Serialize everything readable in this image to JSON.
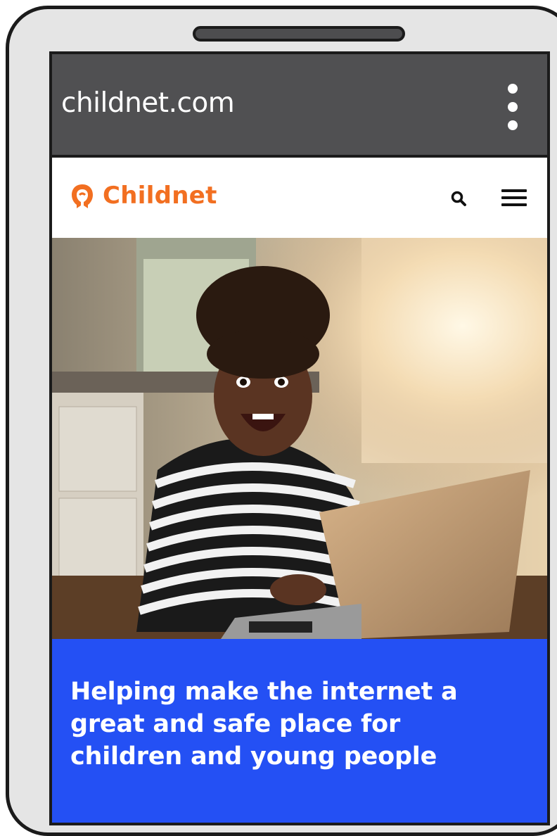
{
  "browser": {
    "url": "childnet.com",
    "menu_icon": "kebab-menu-icon"
  },
  "site": {
    "logo_text": "Childnet",
    "brand_color": "#f26f21",
    "search_icon": "search-icon",
    "menu_icon": "hamburger-menu-icon"
  },
  "hero": {
    "image": "photo of a smiling girl in a striped top using a laptop in a sunlit kitchen"
  },
  "banner": {
    "headline": "Helping make the internet a great and safe place for children and young people",
    "color": "#2450f4"
  }
}
